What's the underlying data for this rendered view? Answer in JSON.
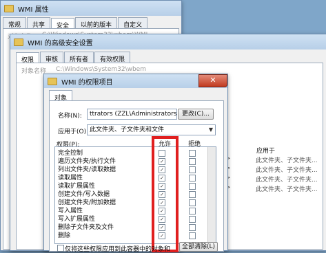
{
  "back_window": {
    "title": "WMI 属性",
    "tabs": [
      "常规",
      "共享",
      "安全",
      "以前的版本",
      "自定义"
    ],
    "active_tab": 2,
    "faint_label": "对象名称",
    "faint_path": "C:\\Windows\\System32\\wbem\\WMI"
  },
  "adv_window": {
    "title": "WMI 的高级安全设置",
    "tabs": [
      "权限",
      "审核",
      "所有者",
      "有效权限"
    ],
    "faint_label": "对象名称",
    "faint_path": "C:\\Windows\\System32\\wbem"
  },
  "perm_entry": {
    "title": "WMI 的权限项目",
    "tab": "对象",
    "name_label": "名称(N):",
    "name_value": "ttrators (ZZL\\Administrators)",
    "change_button": "更改(C)...",
    "apply_label": "应用于(O):",
    "apply_value": "此文件夹、子文件夹和文件",
    "perms_label": "权限(P):",
    "allow_header": "允许",
    "deny_header": "拒绝",
    "permissions": [
      {
        "name": "完全控制",
        "allow": false
      },
      {
        "name": "遍历文件夹/执行文件",
        "allow": true
      },
      {
        "name": "列出文件夹/读取数据",
        "allow": true
      },
      {
        "name": "读取属性",
        "allow": true
      },
      {
        "name": "读取扩展属性",
        "allow": true
      },
      {
        "name": "创建文件/写入数据",
        "allow": true
      },
      {
        "name": "创建文件夹/附加数据",
        "allow": true
      },
      {
        "name": "写入属性",
        "allow": true
      },
      {
        "name": "写入扩展属性",
        "allow": true
      },
      {
        "name": "删除子文件夹及文件",
        "allow": true
      },
      {
        "name": "删除",
        "allow": true
      }
    ],
    "bottom_check_label": "仅将这些权限应用到此容器中的对象和",
    "clear_all_button": "全部清除(L)"
  },
  "right_panel": {
    "header": "应用于",
    "rows": [
      "此文件夹、子文件夹...",
      "此文件夹、子文件夹...",
      "此文件夹、子文件夹...",
      "此文件夹、子文件夹..."
    ],
    "row_prefix": ">"
  },
  "close_glyph": "✕",
  "check_glyph": "✓",
  "colors": {
    "highlight_box": "#e01f1f",
    "desktop": "#7fa6c9"
  }
}
